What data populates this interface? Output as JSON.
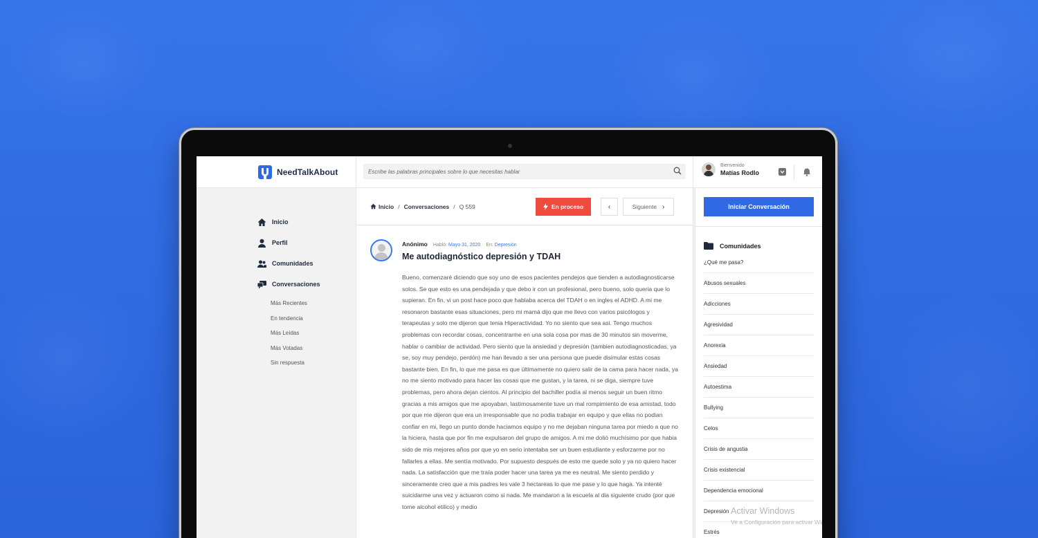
{
  "app": {
    "name": "NeedTalkAbout"
  },
  "search": {
    "placeholder": "Escribe las palabras principales sobre lo que necesitas hablar"
  },
  "user": {
    "greeting": "Bienvenido",
    "name": "Matías Rodlo"
  },
  "sidebar": {
    "items": [
      {
        "label": "Inicio",
        "icon": "home-icon"
      },
      {
        "label": "Perfil",
        "icon": "user-icon"
      },
      {
        "label": "Comunidades",
        "icon": "users-icon"
      },
      {
        "label": "Conversaciones",
        "icon": "chat-icon"
      }
    ],
    "subitems": [
      "Más Recientes",
      "En tendencia",
      "Más Leídas",
      "Más Votadas",
      "Sin respuesta"
    ]
  },
  "breadcrumb": {
    "home": "Inicio",
    "section": "Conversaciones",
    "current": "Q 559"
  },
  "actions": {
    "status": "En proceso",
    "prev": "‹",
    "next": "Siguiente",
    "next_arrow": "›"
  },
  "post": {
    "author": "Anónimo",
    "date_prefix": "Habló:",
    "date": "Mayo 31, 2020",
    "community_prefix": "En:",
    "community": "Depresión",
    "title": "Me autodiagnóstico depresión y TDAH",
    "body": "Bueno, comenzaré diciendo que soy uno de esos pacientes pendejos que tienden a autodiagnosticarse solos. Se que esto es una pendejada y que debo ir con un profesional, pero bueno, solo queria que lo supieran. En fin, vi un post hace poco que hablaba acerca del TDAH o en ingles el ADHD. A mi me resonaron bastante esas situaciones, pero mi mamá dijo que me llevo con varios psicólogos y terapeutas y solo me dijeron que tenia Hiperactividad. Yo no siento que sea asi. Tengo muchos problemas con recordar cosas, concentrarme en una sola cosa por mas de 30 minutos sin moverme, hablar o cambiar de actividad. Pero siento que la ansiedad y depresión (tambien autodiagnosticadas, ya se, soy muy pendejo, perdón) me han llevado a ser una persona que puede disimular estas cosas bastante bien. En fin, lo que me pasa es que últimamente no quiero salir de la cama para hacer nada, ya no me siento motivado para hacer las cosas que me gustan, y la tarea, ni se diga, siempre tuve problemas, pero ahora dejan cientos. Al principio del bachiller podía al menos seguir un buen ritmo gracias a mis amigos que me apoyaban, lastimosamente tuve un mal rompimiento de esa amistad, todo por que me dijeron que era un irresponsable que no podia trabajar en equipo y que ellas no podian confiar en mi, llego un punto donde haciamos equipo y no me dejaban ninguna tarea por miedo a que no la hiciera, hasta que por fin me expulsaron del grupo de amigos. A mi me dolió muchísimo por que habia sido de mis mejores años por que yo en serio intentaba ser un buen estudiante y esforzarme por no fallarles a ellas. Me sentía motivado. Por supuesto después de esto me quede solo y ya no quiero hacer nada. La satisfacción que me traía poder hacer una tarea ya me es neutral. Me siento perdido y sinceramente creo que a mis padres les vale 3 hectareas lo que me pase y lo que haga. Ya intenté suicidarme una vez y actuaron como si nada. Me mandaron a la escuela al dia siguiente crudo (por que tome alcohol etilico) y medio"
  },
  "right": {
    "cta": "Iniciar Conversación",
    "communities_title": "Comunidades",
    "communities": [
      "¿Qué me pasa?",
      "Abusos sexuales",
      "Adicciones",
      "Agresividad",
      "Anorexia",
      "Ansiedad",
      "Autoestima",
      "Bullying",
      "Celos",
      "Crisis de angustia",
      "Crisis existencial",
      "Dependencia emocional",
      "Depresión",
      "Estrés"
    ]
  },
  "watermark": {
    "title": "Activar Windows",
    "subtitle": "Ve a Configuración para activar Windows."
  },
  "colors": {
    "background": "#2f6be3",
    "primary": "#2f6ae4",
    "status": "#ef4b3f",
    "link": "#3a78e6"
  }
}
